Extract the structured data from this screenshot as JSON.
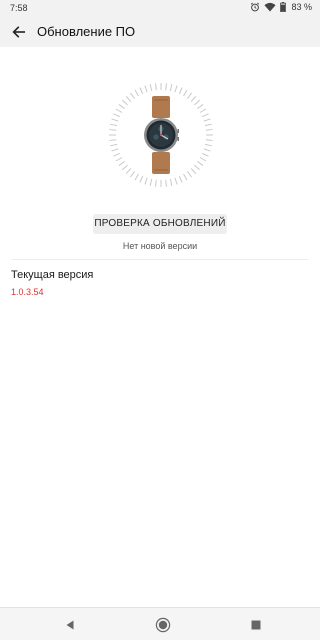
{
  "status_bar": {
    "time": "7:58",
    "battery_text": "83 %",
    "icons": [
      "alarm-icon",
      "wifi-icon",
      "battery-icon"
    ]
  },
  "app_bar": {
    "title": "Обновление ПО",
    "back_icon": "back-arrow-icon"
  },
  "update": {
    "check_button_label": "ПРОВЕРКА ОБНОВЛЕНИЙ",
    "status_text": "Нет новой версии"
  },
  "current_version": {
    "label": "Текущая версия",
    "value": "1.0.3.54"
  },
  "nav_bar": {
    "icons": [
      "nav-back-icon",
      "nav-home-icon",
      "nav-recent-icon"
    ]
  },
  "colors": {
    "accent_red": "#e0312f",
    "bar_background": "#f2f2f2"
  }
}
